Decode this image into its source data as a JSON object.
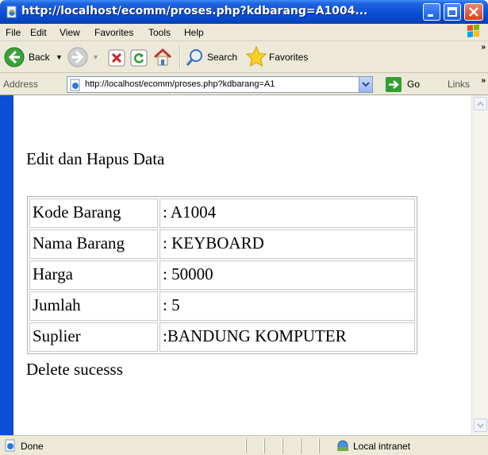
{
  "window": {
    "title": "http://localhost/ecomm/proses.php?kdbarang=A1004..."
  },
  "menu": {
    "items": [
      "File",
      "Edit",
      "View",
      "Favorites",
      "Tools",
      "Help"
    ]
  },
  "toolbar": {
    "back_label": "Back",
    "search_label": "Search",
    "favorites_label": "Favorites"
  },
  "address": {
    "label": "Address",
    "url": "http://localhost/ecomm/proses.php?kdbarang=A1",
    "go_label": "Go",
    "links_label": "Links"
  },
  "page": {
    "title": "Edit dan Hapus Data",
    "rows": [
      {
        "key": "Kode Barang",
        "value": ": A1004"
      },
      {
        "key": "Nama Barang",
        "value": ": KEYBOARD"
      },
      {
        "key": "Harga",
        "value": ": 50000"
      },
      {
        "key": "Jumlah",
        "value": ": 5"
      },
      {
        "key": "Suplier",
        "value": ":BANDUNG KOMPUTER"
      }
    ],
    "message": "Delete sucesss"
  },
  "status": {
    "text": "Done",
    "zone": "Local intranet"
  },
  "icons": [
    "ie-page-icon",
    "back-arrow-icon",
    "forward-arrow-icon",
    "stop-icon",
    "refresh-icon",
    "home-icon",
    "search-icon",
    "favorites-star-icon",
    "go-arrow-icon",
    "windows-logo-icon",
    "intranet-icon"
  ],
  "colors": {
    "titlebar": "#0a4fd6",
    "chrome": "#ece9d8",
    "close": "#d4421a"
  }
}
